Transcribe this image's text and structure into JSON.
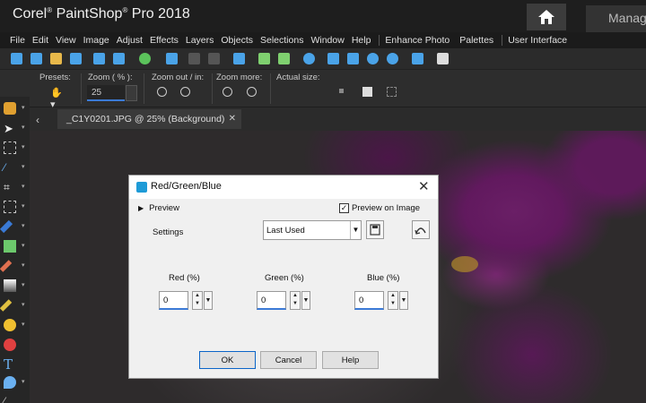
{
  "app": {
    "title": "Corel PaintShop Pro 2018",
    "title_brand": "Corel",
    "title_product": "PaintShop",
    "title_rest": "Pro 2018",
    "manage_tab": "Manage"
  },
  "menu": [
    "File",
    "Edit",
    "View",
    "Image",
    "Adjust",
    "Effects",
    "Layers",
    "Objects",
    "Selections",
    "Window",
    "Help",
    "Enhance Photo",
    "Palettes",
    "User Interface"
  ],
  "options": {
    "presets_label": "Presets:",
    "zoom_label": "Zoom ( % ):",
    "zoom_value": "25",
    "zoom_out_in_label": "Zoom out / in:",
    "zoom_more_label": "Zoom more:",
    "actual_size_label": "Actual size:"
  },
  "document_tab": {
    "label": "_C1Y0201.JPG @  25% (Background)"
  },
  "dialog": {
    "title": "Red/Green/Blue",
    "preview_toggle": "Preview",
    "preview_on_image": "Preview on Image",
    "preview_on_image_checked": true,
    "settings_label": "Settings",
    "settings_value": "Last Used",
    "channels": [
      {
        "label": "Red (%)",
        "value": "0"
      },
      {
        "label": "Green (%)",
        "value": "0"
      },
      {
        "label": "Blue (%)",
        "value": "0"
      }
    ],
    "ok": "OK",
    "cancel": "Cancel",
    "help": "Help"
  },
  "colors": {
    "accent": "#3b7ad6",
    "dialog_icon": "#1e9bd7"
  },
  "icons": [
    "home-icon",
    "new-file-icon",
    "open-icon",
    "save-icon",
    "share-icon",
    "undo-icon",
    "redo-icon",
    "zoom-in-icon",
    "zoom-out-icon",
    "pan-tool-icon",
    "pick-tool-icon",
    "selection-tool-icon",
    "dropper-icon",
    "crop-icon",
    "straighten-icon",
    "brush-icon",
    "eraser-icon",
    "text-tool-icon",
    "shape-icon"
  ]
}
